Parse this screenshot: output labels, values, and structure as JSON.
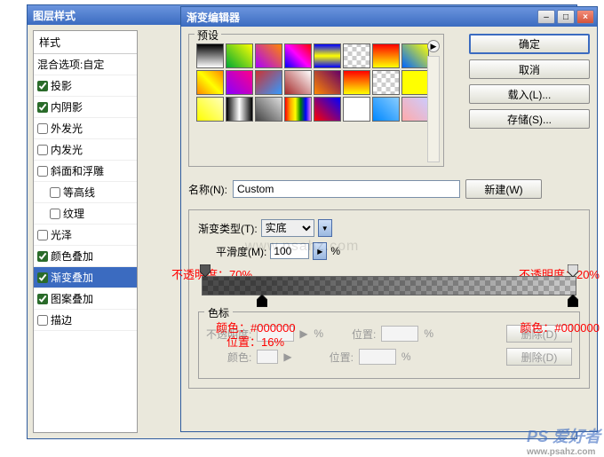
{
  "layerStyles": {
    "title": "图层样式",
    "header": "样式",
    "blendOptions": "混合选项:自定",
    "items": [
      {
        "label": "投影",
        "checked": true,
        "indent": false
      },
      {
        "label": "内阴影",
        "checked": true,
        "indent": false
      },
      {
        "label": "外发光",
        "checked": false,
        "indent": false
      },
      {
        "label": "内发光",
        "checked": false,
        "indent": false
      },
      {
        "label": "斜面和浮雕",
        "checked": false,
        "indent": false
      },
      {
        "label": "等高线",
        "checked": false,
        "indent": true
      },
      {
        "label": "纹理",
        "checked": false,
        "indent": true
      },
      {
        "label": "光泽",
        "checked": false,
        "indent": false
      },
      {
        "label": "颜色叠加",
        "checked": true,
        "indent": false
      },
      {
        "label": "渐变叠加",
        "checked": true,
        "indent": false,
        "selected": true
      },
      {
        "label": "图案叠加",
        "checked": true,
        "indent": false
      },
      {
        "label": "描边",
        "checked": false,
        "indent": false
      }
    ]
  },
  "gradientEditor": {
    "title": "渐变编辑器",
    "presetsLabel": "预设",
    "buttons": {
      "ok": "确定",
      "cancel": "取消",
      "load": "载入(L)...",
      "save": "存储(S)..."
    },
    "nameLabel": "名称(N):",
    "nameValue": "Custom",
    "newBtn": "新建(W)",
    "typeLabel": "渐变类型(T):",
    "typeValue": "实底",
    "smoothLabel": "平滑度(M):",
    "smoothValue": "100",
    "percent": "%",
    "stopsHeader": "色标",
    "opacityLabel": "不透明度:",
    "positionLabel": "位置:",
    "colorLabel": "颜色:",
    "deleteLabel": "删除(D)",
    "presets": [
      "linear-gradient(#000,#fff)",
      "linear-gradient(45deg,#0a3,#ff0)",
      "linear-gradient(45deg,#a0f,#f80)",
      "linear-gradient(45deg,#00f,#f0f,#f00)",
      "linear-gradient(#00f,#ff0,#00f)",
      "repeating-conic-gradient(#ccc 0 25%,#fff 0 50%) 50%/10px 10px",
      "linear-gradient(#f00,#ff0)",
      "linear-gradient(45deg,#06f,#ff0)",
      "linear-gradient(45deg,#f80,#ff0,#f80)",
      "linear-gradient(45deg,#80f,#f08)",
      "linear-gradient(135deg,#c33,#39f)",
      "linear-gradient(45deg,#a52a2a,#fff)",
      "linear-gradient(45deg,#f80,#606)",
      "linear-gradient(#f00,#ff0)",
      "repeating-conic-gradient(#ccc 0 25%,#fff 0 50%) 50%/10px 10px,linear-gradient(rgba(255,255,255,.6),rgba(255,255,255,.6))",
      "linear-gradient(#ff0,#ff0)",
      "linear-gradient(45deg,#ff0,#ffb)",
      "linear-gradient(90deg,#000,#fff,#000)",
      "linear-gradient(45deg,#444,#ddd)",
      "linear-gradient(90deg,red,orange,yellow,green,blue,violet)",
      "linear-gradient(45deg,#f00,#00f)",
      "linear-gradient(90deg,#fff,#fff)",
      "linear-gradient(45deg,#08f,#8cf)",
      "linear-gradient(45deg,#faa,#ccf)"
    ]
  },
  "annotations": {
    "opLeft": "不透明度：70%",
    "opRight": "不透明度：20%",
    "colLeft": "颜色：#000000",
    "colRight": "颜色：#000000",
    "pos": "位置：16%"
  },
  "watermark": {
    "main": "PS 爱好者",
    "sub": "www.psahz.com"
  },
  "wmCenter": "www.psahz.com"
}
